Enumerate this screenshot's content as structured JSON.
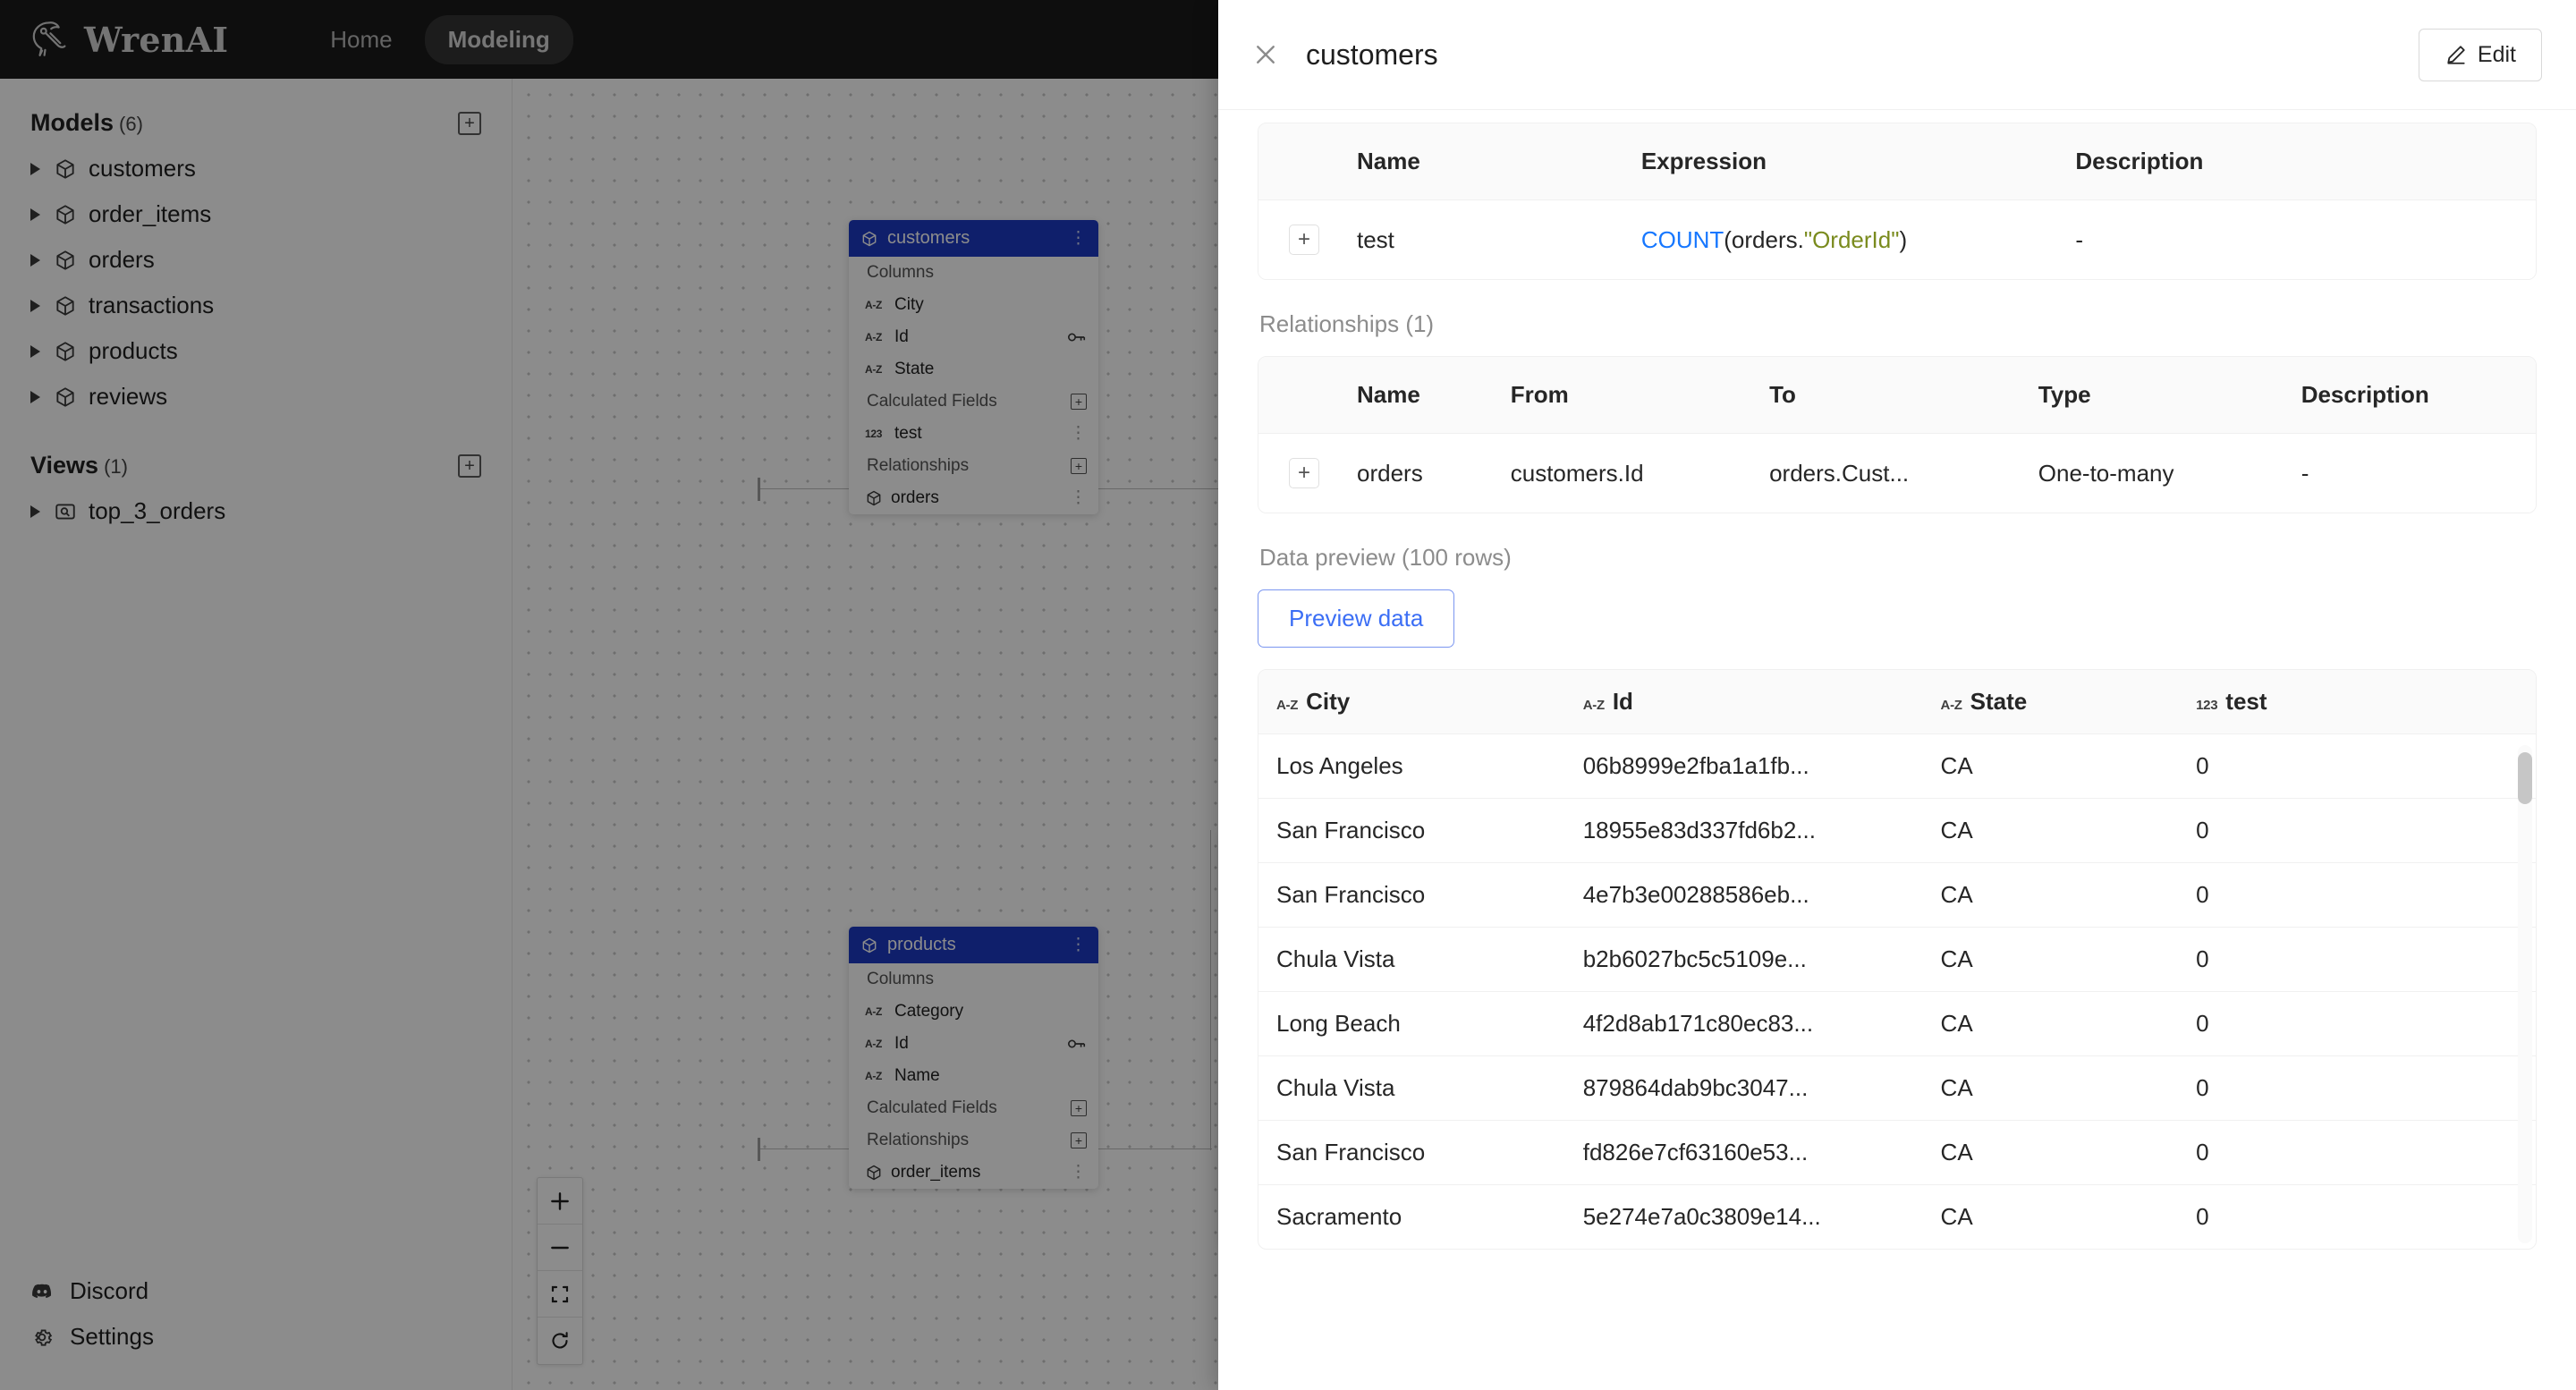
{
  "topbar": {
    "brand": "WrenAI",
    "logo_icon": "wren-bird-logo",
    "nav": [
      {
        "label": "Home",
        "active": false
      },
      {
        "label": "Modeling",
        "active": true
      }
    ]
  },
  "sidebar": {
    "sections": [
      {
        "title": "Models",
        "count": "(6)",
        "add_icon": "plus-square-icon",
        "items": [
          {
            "label": "customers",
            "icon": "model-cube-icon"
          },
          {
            "label": "order_items",
            "icon": "model-cube-icon"
          },
          {
            "label": "orders",
            "icon": "model-cube-icon"
          },
          {
            "label": "transactions",
            "icon": "model-cube-icon"
          },
          {
            "label": "products",
            "icon": "model-cube-icon"
          },
          {
            "label": "reviews",
            "icon": "model-cube-icon"
          }
        ]
      },
      {
        "title": "Views",
        "count": "(1)",
        "add_icon": "plus-square-icon",
        "items": [
          {
            "label": "top_3_orders",
            "icon": "view-icon"
          }
        ]
      }
    ],
    "bottom": [
      {
        "label": "Discord",
        "icon": "discord-icon"
      },
      {
        "label": "Settings",
        "icon": "gear-icon"
      }
    ]
  },
  "canvas": {
    "zoom_controls": [
      {
        "name": "zoom-in",
        "glyph": "+"
      },
      {
        "name": "zoom-out",
        "glyph": "−"
      },
      {
        "name": "fit-view",
        "glyph": "fit"
      },
      {
        "name": "reset-layout",
        "glyph": "reset"
      }
    ],
    "nodes": [
      {
        "title": "customers",
        "sections": [
          {
            "label": "Columns",
            "add": false
          },
          {
            "label": "Calculated Fields",
            "add": true
          },
          {
            "label": "Relationships",
            "add": true
          }
        ],
        "columns": [
          {
            "name": "City",
            "type": "A-Z",
            "primary_key": false
          },
          {
            "name": "Id",
            "type": "A-Z",
            "primary_key": true
          },
          {
            "name": "State",
            "type": "A-Z",
            "primary_key": false
          }
        ],
        "calculated_fields": [
          {
            "name": "test",
            "type": "123"
          }
        ],
        "relationships": [
          {
            "name": "orders",
            "icon": "model-cube-icon"
          }
        ]
      },
      {
        "title": "products",
        "sections": [
          {
            "label": "Columns",
            "add": false
          },
          {
            "label": "Calculated Fields",
            "add": true
          },
          {
            "label": "Relationships",
            "add": true
          }
        ],
        "columns": [
          {
            "name": "Category",
            "type": "A-Z",
            "primary_key": false
          },
          {
            "name": "Id",
            "type": "A-Z",
            "primary_key": true
          },
          {
            "name": "Name",
            "type": "A-Z",
            "primary_key": false
          }
        ],
        "calculated_fields": [],
        "relationships": [
          {
            "name": "order_items",
            "icon": "model-cube-icon"
          }
        ]
      }
    ]
  },
  "drawer": {
    "close_icon": "close-icon",
    "title": "customers",
    "edit_button": {
      "label": "Edit",
      "icon": "pencil-icon"
    },
    "calculated_fields_table": {
      "headers": [
        "Name",
        "Expression",
        "Description"
      ],
      "rows": [
        {
          "expand": "+",
          "name": "test",
          "expr_fn": "COUNT",
          "expr_open": "(orders.",
          "expr_str": "\"OrderId\"",
          "expr_close": ")",
          "description": "-"
        }
      ]
    },
    "relationships": {
      "label": "Relationships (1)",
      "headers": [
        "Name",
        "From",
        "To",
        "Type",
        "Description"
      ],
      "rows": [
        {
          "expand": "+",
          "name": "orders",
          "from": "customers.Id",
          "to": "orders.Cust...",
          "type": "One-to-many",
          "description": "-"
        }
      ]
    },
    "data_preview": {
      "label": "Data preview (100 rows)",
      "preview_button": "Preview data",
      "headers": [
        {
          "type": "A-Z",
          "label": "City"
        },
        {
          "type": "A-Z",
          "label": "Id"
        },
        {
          "type": "A-Z",
          "label": "State"
        },
        {
          "type": "123",
          "label": "test"
        }
      ],
      "rows": [
        {
          "city": "Los Angeles",
          "id": "06b8999e2fba1a1fb...",
          "state": "CA",
          "test": "0"
        },
        {
          "city": "San Francisco",
          "id": "18955e83d337fd6b2...",
          "state": "CA",
          "test": "0"
        },
        {
          "city": "San Francisco",
          "id": "4e7b3e00288586eb...",
          "state": "CA",
          "test": "0"
        },
        {
          "city": "Chula Vista",
          "id": "b2b6027bc5c5109e...",
          "state": "CA",
          "test": "0"
        },
        {
          "city": "Long Beach",
          "id": "4f2d8ab171c80ec83...",
          "state": "CA",
          "test": "0"
        },
        {
          "city": "Chula Vista",
          "id": "879864dab9bc3047...",
          "state": "CA",
          "test": "0"
        },
        {
          "city": "San Francisco",
          "id": "fd826e7cf63160e53...",
          "state": "CA",
          "test": "0"
        },
        {
          "city": "Sacramento",
          "id": "5e274e7a0c3809e14...",
          "state": "CA",
          "test": "0"
        }
      ]
    }
  },
  "colors": {
    "brand_dark": "#1a1a1a",
    "node_header": "#1d39c4",
    "accent_link": "#3b6ef5",
    "expr_fn": "#1677ff",
    "expr_string": "#7a8b1e"
  }
}
